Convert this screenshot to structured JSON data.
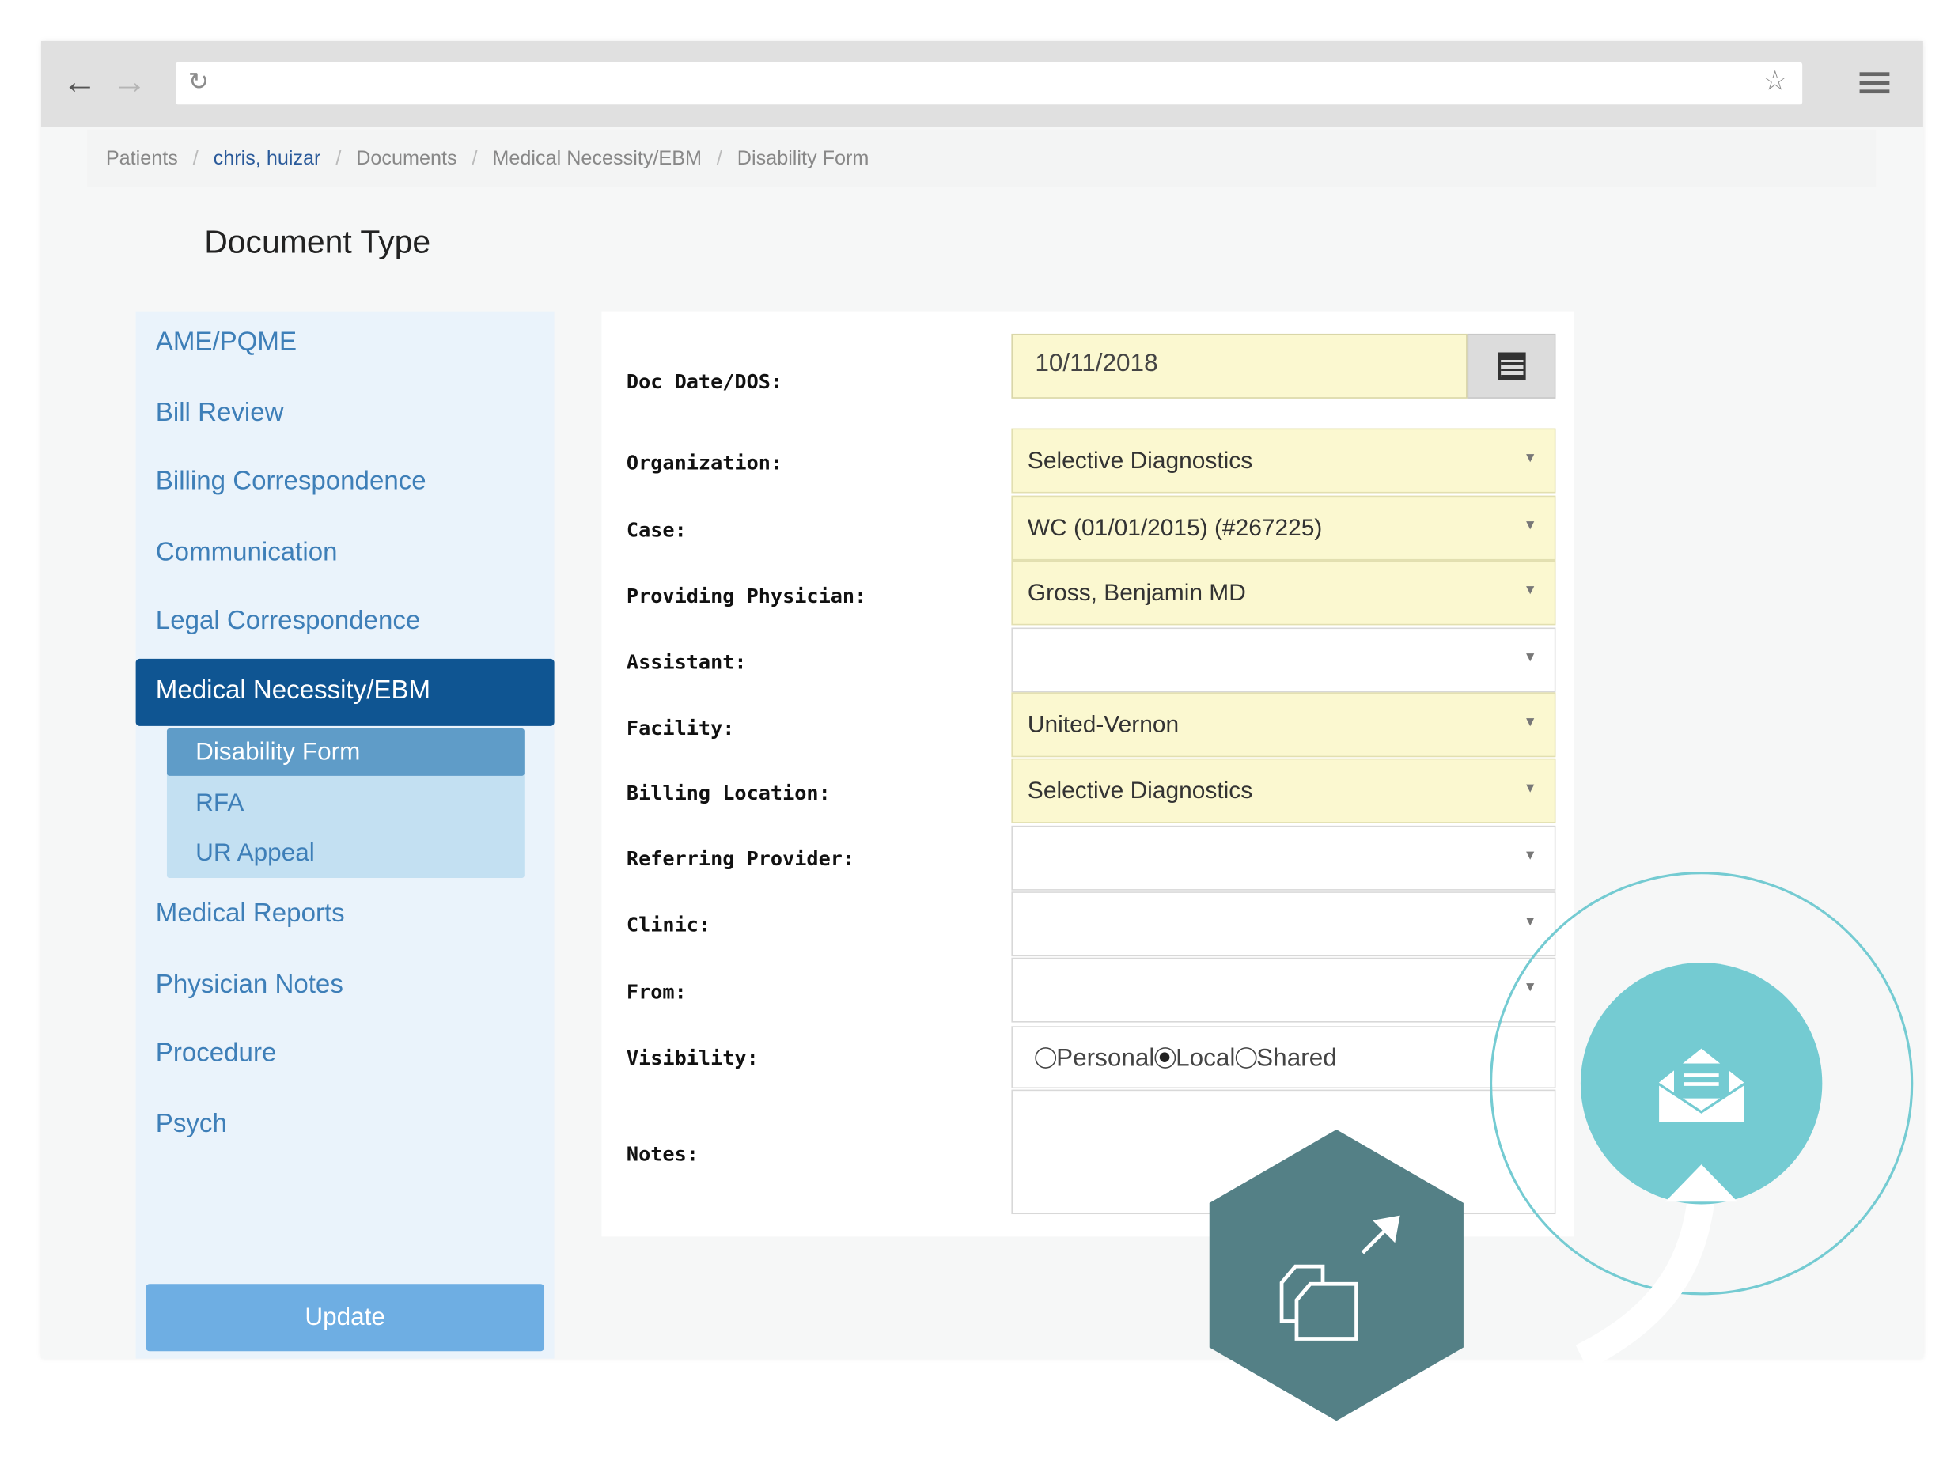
{
  "breadcrumb": [
    {
      "label": "Patients",
      "link": false
    },
    {
      "label": "chris, huizar",
      "link": true
    },
    {
      "label": "Documents",
      "link": false
    },
    {
      "label": "Medical Necessity/EBM",
      "link": false
    },
    {
      "label": "Disability Form",
      "link": false
    }
  ],
  "page": {
    "title": "Document Type"
  },
  "sidebar": {
    "items": [
      "AME/PQME",
      "Bill Review",
      "Billing Correspondence",
      "Communication",
      "Legal Correspondence"
    ],
    "active": "Medical Necessity/EBM",
    "submenu": {
      "active": "Disability Form",
      "items": [
        "RFA",
        "UR Appeal"
      ]
    },
    "items_after": [
      "Medical Reports",
      "Physician Notes",
      "Procedure",
      "Psych"
    ],
    "update_label": "Update"
  },
  "form": {
    "doc_date": {
      "label": "Doc Date/DOS:",
      "value": "10/11/2018"
    },
    "organization": {
      "label": "Organization:",
      "value": "Selective Diagnostics"
    },
    "case": {
      "label": "Case:",
      "value": "WC (01/01/2015) (#267225)"
    },
    "providing_physician": {
      "label": "Providing Physician:",
      "value": "Gross, Benjamin MD"
    },
    "assistant": {
      "label": "Assistant:",
      "value": ""
    },
    "facility": {
      "label": "Facility:",
      "value": "United-Vernon"
    },
    "billing_location": {
      "label": "Billing Location:",
      "value": "Selective Diagnostics"
    },
    "referring_provider": {
      "label": "Referring Provider:",
      "value": ""
    },
    "clinic": {
      "label": "Clinic:",
      "value": ""
    },
    "from": {
      "label": "From:",
      "value": ""
    },
    "visibility": {
      "label": "Visibility:",
      "options": [
        "Personal",
        "Local",
        "Shared"
      ],
      "selected": "Local"
    },
    "notes": {
      "label": "Notes:",
      "value": ""
    }
  },
  "colors": {
    "accent_navy": "#0f5592",
    "link_blue": "#3e7fb8",
    "required_field": "#fbf8d0",
    "update_button": "#6eaee3",
    "hexagon": "#548086",
    "email_circle": "#74cbd2"
  },
  "icons": {
    "back": "arrow-left-icon",
    "forward": "arrow-right-icon",
    "reload": "reload-icon",
    "bookmark": "star-icon",
    "menu": "hamburger-icon",
    "calendar": "calendar-icon",
    "dropdown": "caret-down-icon",
    "documents_export": "documents-export-icon",
    "email": "envelope-open-icon"
  }
}
